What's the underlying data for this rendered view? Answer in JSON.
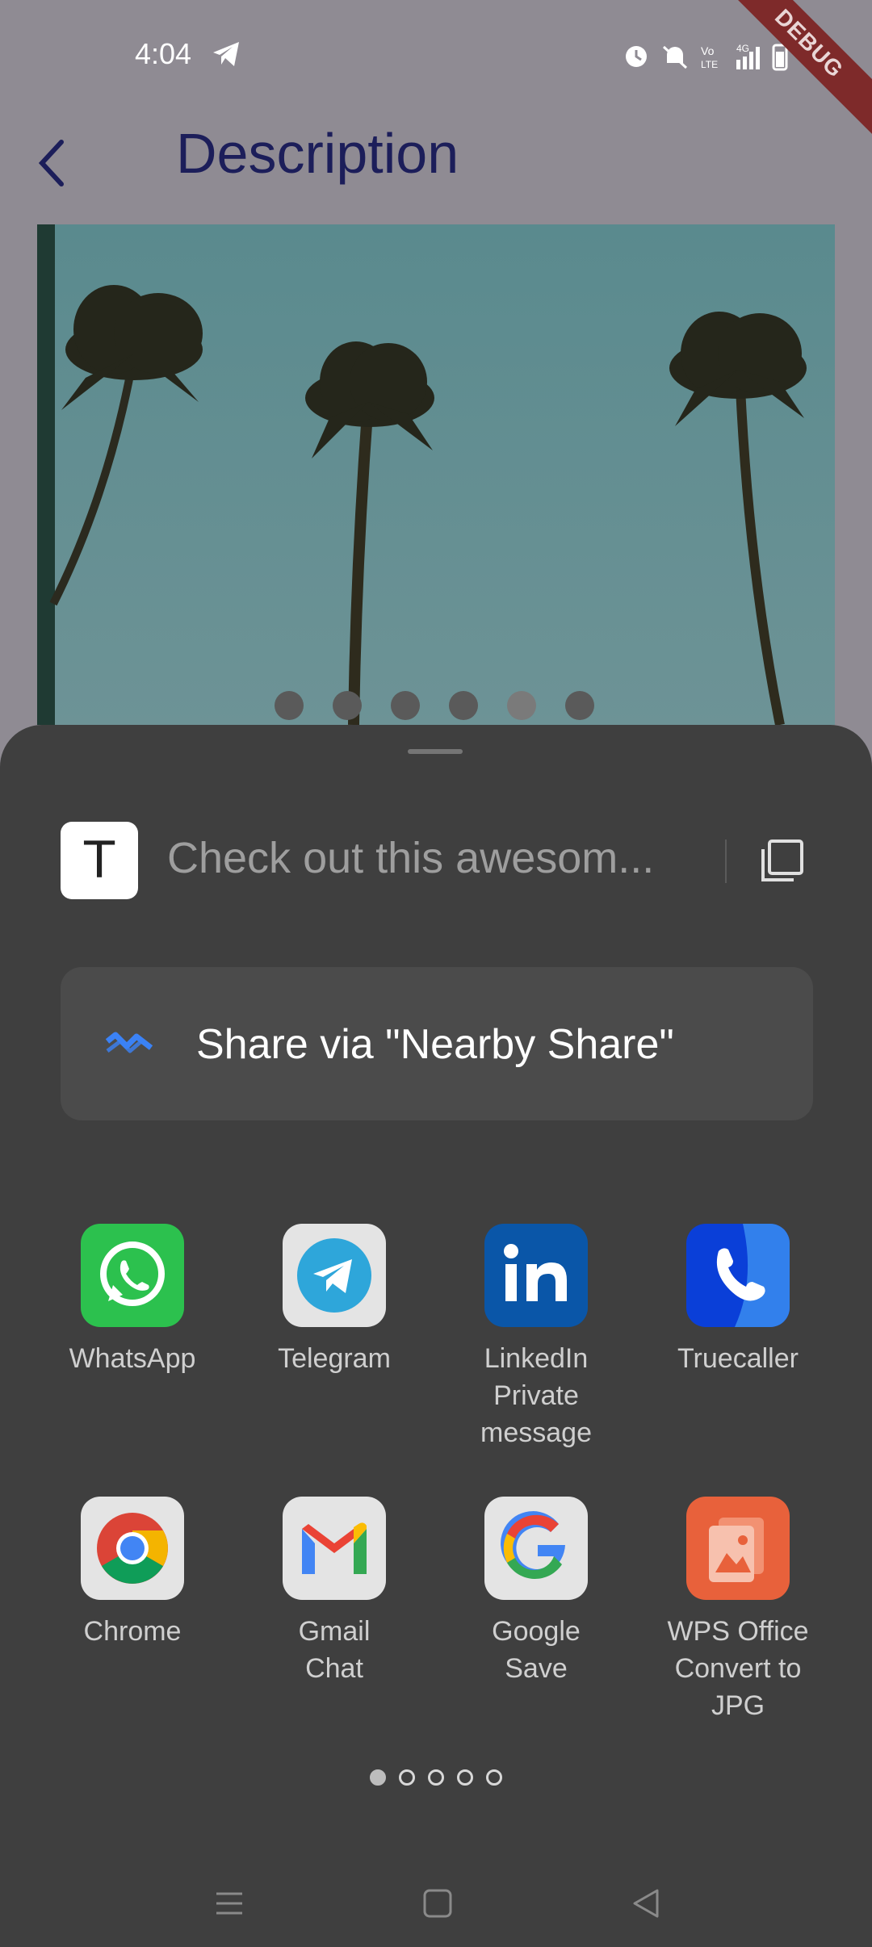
{
  "status_bar": {
    "time": "4:04",
    "debug_banner": "DEBUG"
  },
  "app_bar": {
    "title": "Description"
  },
  "carousel": {
    "dot_count": 6
  },
  "share_sheet": {
    "preview_text": "Check out this awesom...",
    "text_icon_glyph": "T",
    "nearby_share_label": "Share via \"Nearby Share\"",
    "apps": [
      {
        "label": "WhatsApp",
        "icon": "whatsapp-icon",
        "color": "#25d366"
      },
      {
        "label": "Telegram",
        "icon": "telegram-icon",
        "color": "#2ea6da"
      },
      {
        "label": "LinkedIn\nPrivate\nmessage",
        "icon": "linkedin-icon",
        "color": "#0a66c2"
      },
      {
        "label": "Truecaller",
        "icon": "truecaller-icon",
        "color": "#0a6cf1"
      },
      {
        "label": "Chrome",
        "icon": "chrome-icon",
        "color": "#ffffff"
      },
      {
        "label": "Gmail\nChat",
        "icon": "gmail-icon",
        "color": "#ffffff"
      },
      {
        "label": "Google\nSave",
        "icon": "google-icon",
        "color": "#ffffff"
      },
      {
        "label": "WPS Office\nConvert to\nJPG",
        "icon": "wps-office-icon",
        "color": "#e8613b"
      }
    ],
    "page_count": 5,
    "active_page": 1
  },
  "colors": {
    "sheet_background": "#3f3f3f",
    "title_color": "#1c1e5a",
    "nearby_accent": "#3b82f6"
  }
}
